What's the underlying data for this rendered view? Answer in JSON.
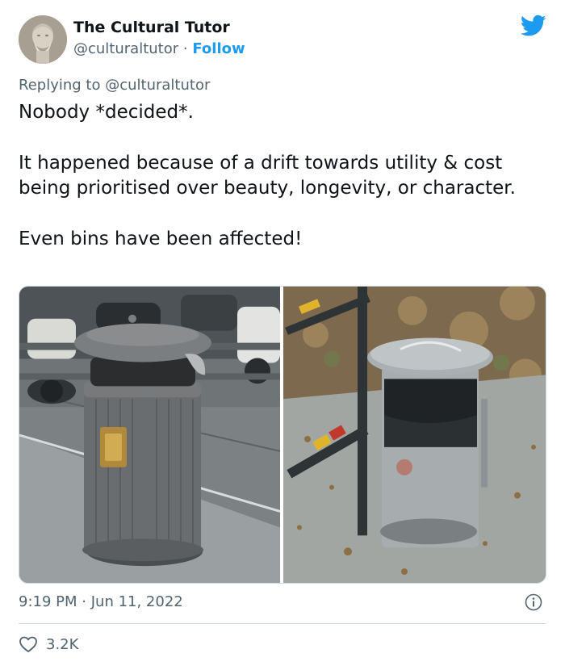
{
  "author": {
    "name": "The Cultural Tutor",
    "handle": "@culturaltutor",
    "separator": "·",
    "follow_label": "Follow"
  },
  "reply": {
    "prefix": "Replying to",
    "handle": "@culturaltutor"
  },
  "tweet": {
    "paragraph1": "Nobody *decided*.",
    "paragraph2": "It happened because of a drift towards utility & cost being prioritised over beauty, longevity, or character.",
    "paragraph3": "Even bins have been affected!"
  },
  "media": {
    "left_photo": "ornate-cast-iron-bin",
    "right_photo": "plain-metal-bin-on-pole"
  },
  "meta": {
    "time": "9:19 PM",
    "separator": "·",
    "date": "Jun 11, 2022"
  },
  "engagement": {
    "likes": "3.2K"
  },
  "colors": {
    "accent": "#1d9bf0",
    "text": "#0f1419",
    "muted": "#536471",
    "border": "#cfd9de"
  },
  "icons": {
    "brand": "twitter-bird-icon",
    "info": "info-icon",
    "like": "heart-icon"
  }
}
